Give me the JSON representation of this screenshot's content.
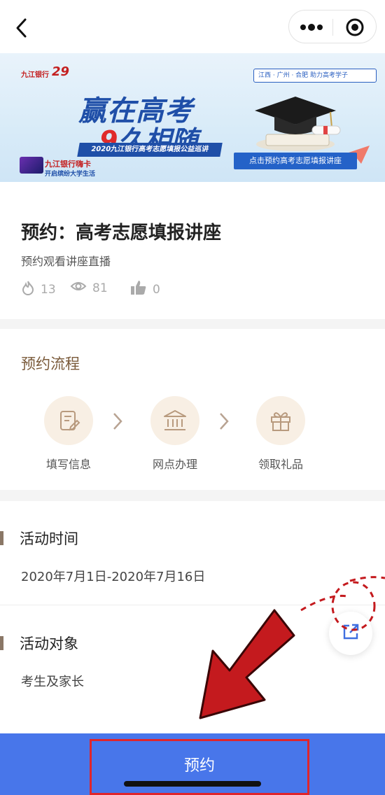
{
  "nav": {
    "back_icon": "chevron-left-icon",
    "more_icon": "more-dots-icon",
    "close_icon": "target-circle-icon"
  },
  "banner": {
    "bank_logo": "九江银行",
    "anniversary": "29",
    "headline_line1": "赢在高考",
    "headline_line2_num": "9",
    "headline_line2_rest": "久相随",
    "ribbon": "2020九江银行高考志愿填报公益巡讲",
    "locations": "江西 · 广州 · 合肥   助力高考学子",
    "cta": "点击预约高考志愿填报讲座",
    "card_title": "九江银行嗨卡",
    "card_sub": "开启缤纷大学生活"
  },
  "event": {
    "title": "预约：高考志愿填报讲座",
    "subtitle": "预约观看讲座直播",
    "hot_count": "13",
    "view_count": "81",
    "like_count": "0"
  },
  "process": {
    "heading": "预约流程",
    "steps": [
      {
        "label": "填写信息",
        "icon": "form-edit-icon"
      },
      {
        "label": "网点办理",
        "icon": "bank-building-icon"
      },
      {
        "label": "领取礼品",
        "icon": "gift-icon"
      }
    ]
  },
  "details": {
    "time_heading": "活动时间",
    "time_value": "2020年7月1日-2020年7月16日",
    "target_heading": "活动对象",
    "target_value": "考生及家长"
  },
  "fab": {
    "icon": "share-icon"
  },
  "footer": {
    "book_label": "预约"
  },
  "colors": {
    "accent_blue": "#4876ea",
    "process_brown": "#7a5a3a",
    "annotation_red": "#e0252b"
  }
}
